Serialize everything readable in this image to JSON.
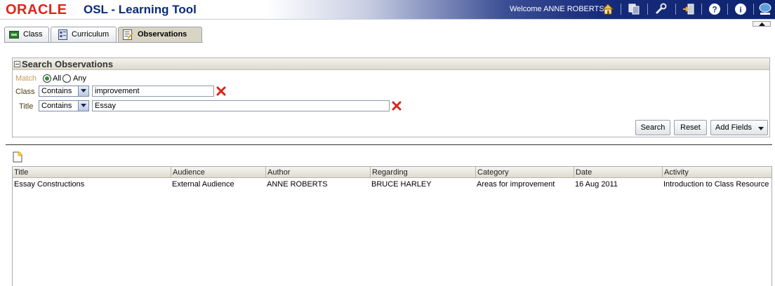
{
  "header": {
    "logo": "ORACLE",
    "app_title": "OSL - Learning Tool",
    "welcome": "Welcome ANNE ROBERTS",
    "icons": [
      "home-icon",
      "switch-icon",
      "tools-icon",
      "logout-icon",
      "help-icon",
      "info-icon",
      "chat-icon"
    ]
  },
  "tabs": [
    {
      "label": "Class",
      "icon": "class-icon"
    },
    {
      "label": "Curriculum",
      "icon": "curriculum-icon"
    },
    {
      "label": "Observations",
      "icon": "observations-icon",
      "active": true
    }
  ],
  "search": {
    "title": "Search Observations",
    "match_label": "Match",
    "match_all": "All",
    "match_any": "Any",
    "match_selected": "All",
    "rows": [
      {
        "label": "Class",
        "operator": "Contains",
        "value": "improvement"
      },
      {
        "label": "Title",
        "operator": "Contains",
        "value": "Essay"
      }
    ],
    "buttons": {
      "search": "Search",
      "reset": "Reset",
      "add_fields": "Add Fields"
    }
  },
  "table": {
    "columns": [
      "Title",
      "Audience",
      "Author",
      "Regarding",
      "Category",
      "Date",
      "Activity"
    ],
    "rows": [
      [
        "Essay Constructions",
        "External Audience",
        "ANNE ROBERTS",
        "BRUCE HARLEY",
        "Areas for improvement",
        "16 Aug 2011",
        "Introduction to Class Resource"
      ]
    ]
  },
  "colors": {
    "oracle_red": "#e2231a",
    "header_navy": "#0f2470",
    "title_blue": "#0a2a7a",
    "delete_red": "#d4261c"
  }
}
